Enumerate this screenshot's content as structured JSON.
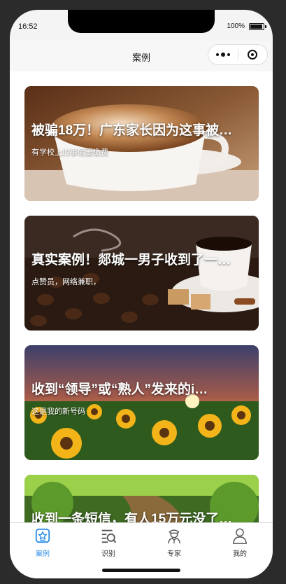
{
  "status": {
    "time": "16:52",
    "battery": "100%"
  },
  "nav": {
    "title": "案例"
  },
  "cards": [
    {
      "title": "被骗18万！广东家长因为这事被…",
      "subtitle": "有学校上的事情要缴费"
    },
    {
      "title": "真实案例！郯城一男子收到了一…",
      "subtitle": "点赞员，网络兼职，"
    },
    {
      "title": "收到“领导”或“熟人”发来的i…",
      "subtitle": "这是我的新号码"
    },
    {
      "title": "收到一条短信，有人15万元没了…",
      "subtitle": ""
    }
  ],
  "tabbar": {
    "items": [
      {
        "label": "案例",
        "icon": "case-icon",
        "active": true
      },
      {
        "label": "识别",
        "icon": "identify-icon",
        "active": false
      },
      {
        "label": "专家",
        "icon": "expert-icon",
        "active": false
      },
      {
        "label": "我的",
        "icon": "profile-icon",
        "active": false
      }
    ],
    "active_color": "#2a8ce8"
  }
}
